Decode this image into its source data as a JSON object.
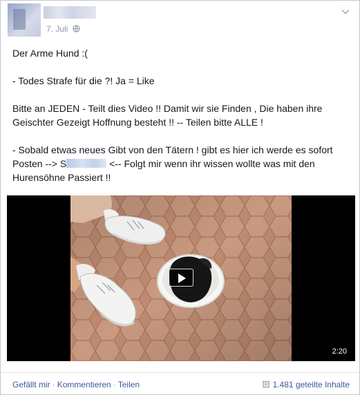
{
  "header": {
    "date": "7. Juli"
  },
  "post": {
    "line1": "Der Arme Hund :(",
    "line2": "- Todes Strafe für die ?! Ja = Like",
    "line3a": "Bitte an JEDEN - Teilt dies Video !! Damit wir sie Finden , Die haben ihre",
    "line3b": "Geischter Gezeigt Hoffnung besteht !! -- Teilen bitte ALLE !",
    "line4a": "- Sobald etwas neues Gibt von den Tätern ! gibt es hier ich werde es sofort",
    "line4b_prefix": "Posten --> S",
    "line4b_suffix": " <-- Folgt mir wenn ihr wissen wollte was mit den",
    "line4c": "Hurensöhne Passiert !!"
  },
  "video": {
    "duration": "2:20"
  },
  "footer": {
    "like": "Gefällt mir",
    "separator": "·",
    "comment": "Kommentieren",
    "share": "Teilen",
    "shares_count": "1.481 geteilte Inhalte"
  },
  "colors": {
    "link": "#3b5998",
    "muted": "#9197a3",
    "border": "#c4c7cc"
  }
}
